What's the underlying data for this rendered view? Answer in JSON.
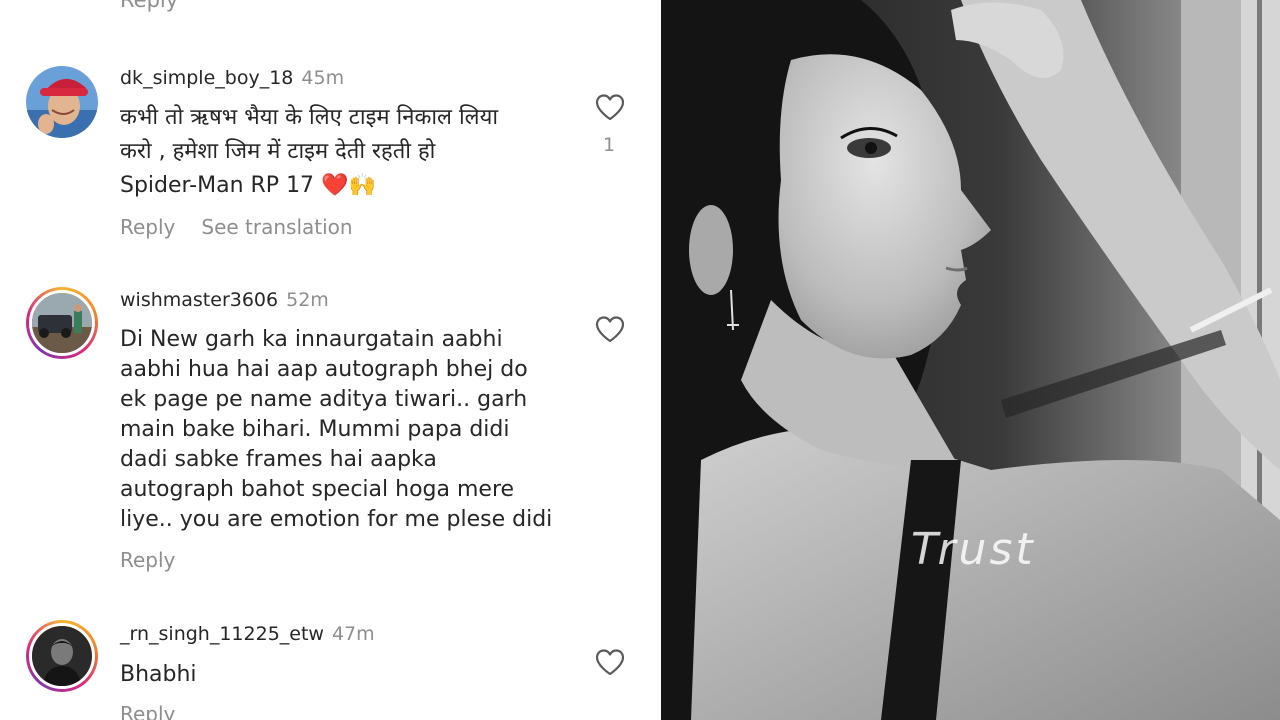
{
  "top_reply_label": "Reply",
  "comments": [
    {
      "username": "dk_simple_boy_18",
      "time": "45m",
      "lines": [
        "कभी तो ऋषभ भैया के लिए टाइम निकाल लिया",
        "करो , हमेशा जिम में टाइम देती रहती हो",
        "Spider-Man RP 17 ❤️🙌"
      ],
      "like_count": "1",
      "reply_label": "Reply",
      "translate_label": "See translation"
    },
    {
      "username": "wishmaster3606",
      "time": "52m",
      "lines": [
        "Di New garh ka innaurgatain aabhi",
        "aabhi hua hai aap autograph bhej do",
        "ek page pe name aditya tiwari.. garh",
        "main bake bihari. Mummi papa didi",
        "dadi sabke frames hai aapka",
        "autograph bahot special hoga mere",
        "liye.. you are emotion for me plese didi"
      ],
      "reply_label": "Reply"
    },
    {
      "username": "_rn_singh_11225_etw",
      "time": "47m",
      "lines": [
        "Bhabhi"
      ],
      "reply_label": "Reply"
    }
  ],
  "photo": {
    "watermark": "Trust"
  },
  "icons": {
    "like": "heart-outline-icon"
  },
  "colors": {
    "primary_text": "#262626",
    "secondary_text": "#8e8e8e",
    "story_ring_start": "#f7b733",
    "story_ring_end": "#8134af"
  }
}
